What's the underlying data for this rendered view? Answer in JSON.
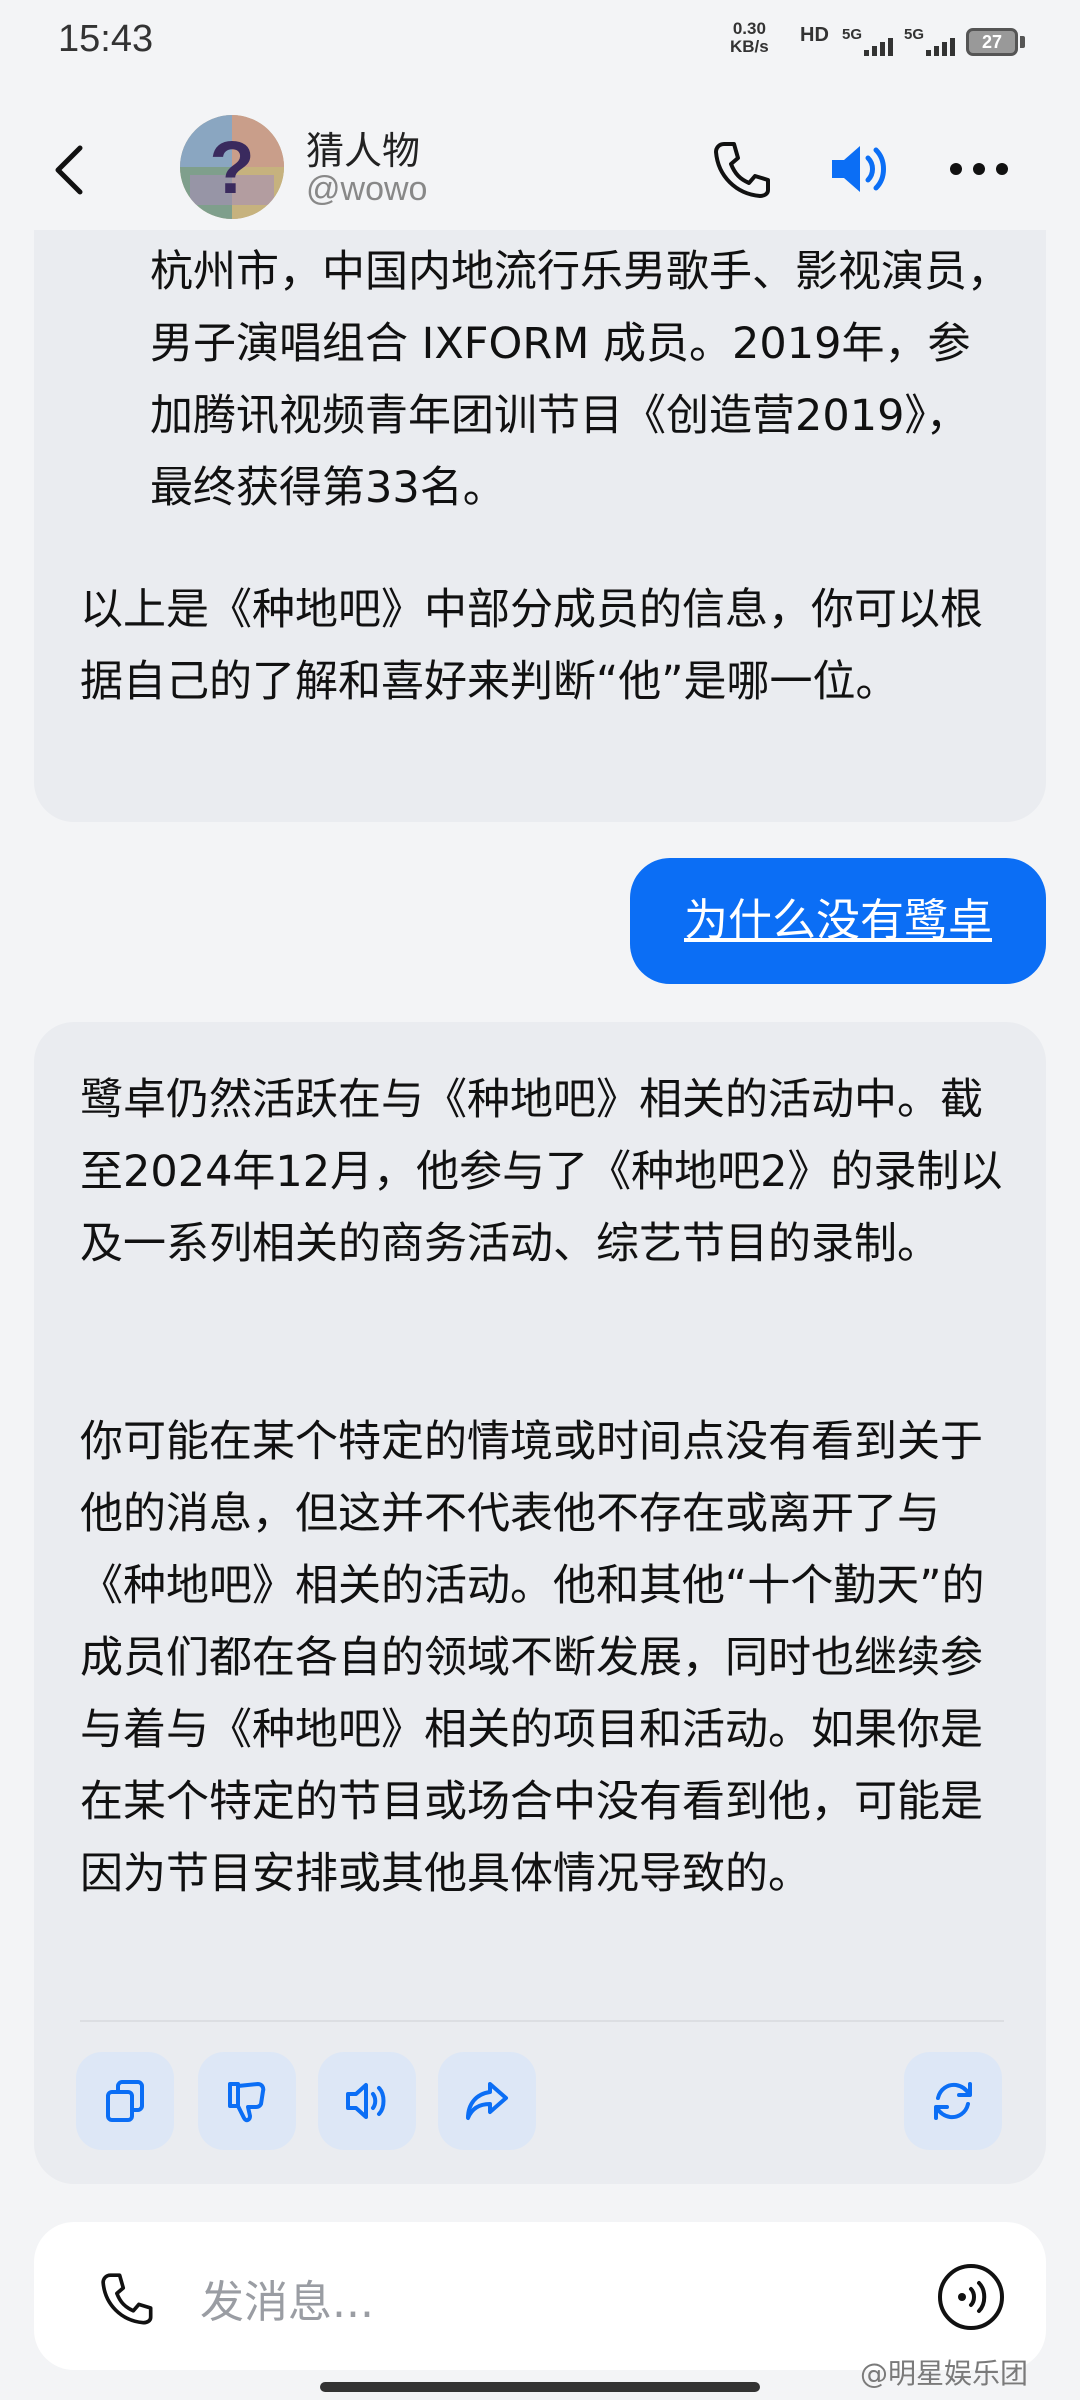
{
  "status": {
    "time": "15:43",
    "net_speed_value": "0.30",
    "net_speed_unit": "KB/s",
    "hd": "HD",
    "sig1": "5G",
    "sig2": "5G",
    "battery": "27"
  },
  "header": {
    "name": "猜人物",
    "handle": "@wowo"
  },
  "messages": {
    "bot1": {
      "p1": "杭州市，中国内地流行乐男歌手、影视演员，男子演唱组合 IXFORM 成员。2019年，参加腾讯视频青年团训节目《创造营2019》，最终获得第33名。",
      "p2": "以上是《种地吧》中部分成员的信息，你可以根据自己的了解和喜好来判断“他”是哪一位。"
    },
    "user1": "为什么没有鹭卓",
    "bot2": {
      "p1": "鹭卓仍然活跃在与《种地吧》相关的活动中。截至2024年12月，他参与了《种地吧2》的录制以及一系列相关的商务活动、综艺节目的录制。",
      "p2": "你可能在某个特定的情境或时间点没有看到关于他的消息，但这并不代表他不存在或离开了与《种地吧》相关的活动。他和其他“十个勤天”的成员们都在各自的领域不断发展，同时也继续参与着与《种地吧》相关的项目和活动。如果你是在某个特定的节目或场合中没有看到他，可能是因为节目安排或其他具体情况导致的。"
    }
  },
  "input": {
    "placeholder": "发消息..."
  },
  "watermark": "@明星娱乐团",
  "icons": {
    "back": "chevron-left-icon",
    "call": "phone-icon",
    "speaker": "speaker-icon",
    "more": "more-icon",
    "copy": "copy-icon",
    "dislike": "thumbs-down-icon",
    "read_aloud": "speaker-icon",
    "share": "share-icon",
    "regenerate": "refresh-icon",
    "voice": "voice-input-icon"
  },
  "colors": {
    "accent": "#0b6ef5",
    "bot_bubble": "#eaecf0",
    "action_bg": "#dde7f6",
    "background": "#f3f4f6"
  }
}
